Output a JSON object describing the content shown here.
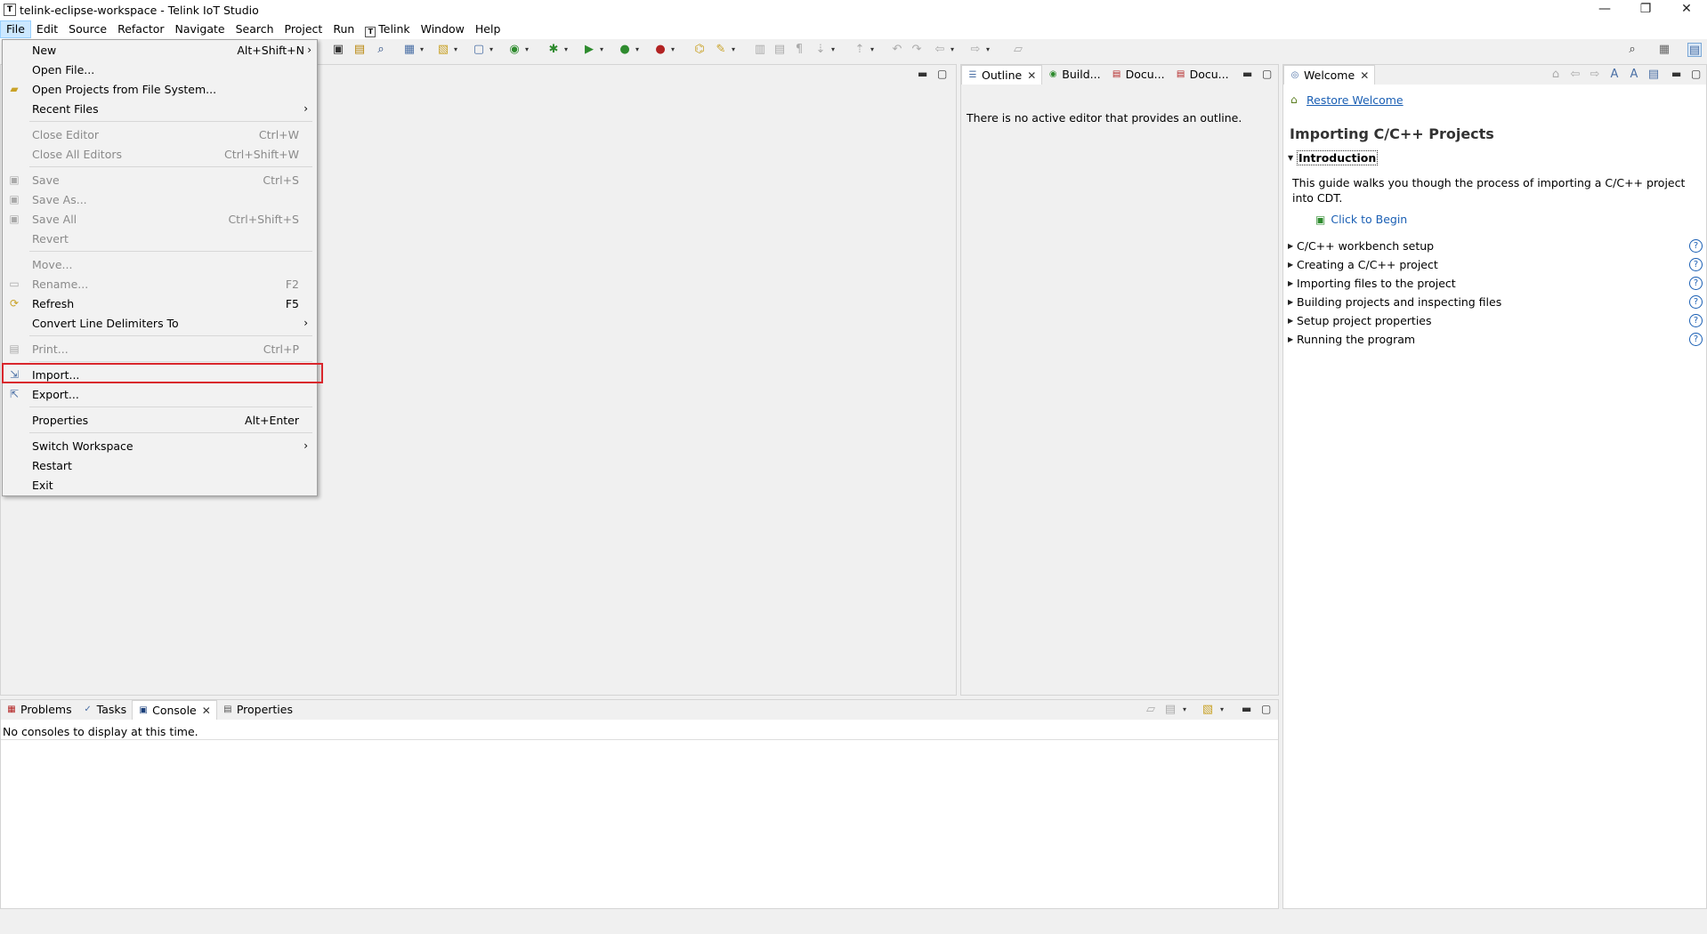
{
  "window": {
    "title": "telink-eclipse-workspace - Telink IoT Studio",
    "icon": "app-icon",
    "controls": {
      "minimize": "—",
      "restore": "❐",
      "close": "✕"
    }
  },
  "menubar": {
    "items": [
      "File",
      "Edit",
      "Source",
      "Refactor",
      "Navigate",
      "Search",
      "Project",
      "Run",
      "Telink",
      "Window",
      "Help"
    ]
  },
  "file_menu": {
    "new": {
      "label": "New",
      "shortcut": "Alt+Shift+N"
    },
    "open_file": {
      "label": "Open File..."
    },
    "open_projects": {
      "label": "Open Projects from File System..."
    },
    "recent_files": {
      "label": "Recent Files"
    },
    "close_editor": {
      "label": "Close Editor",
      "shortcut": "Ctrl+W"
    },
    "close_all_editors": {
      "label": "Close All Editors",
      "shortcut": "Ctrl+Shift+W"
    },
    "save": {
      "label": "Save",
      "shortcut": "Ctrl+S"
    },
    "save_as": {
      "label": "Save As..."
    },
    "save_all": {
      "label": "Save All",
      "shortcut": "Ctrl+Shift+S"
    },
    "revert": {
      "label": "Revert"
    },
    "move": {
      "label": "Move..."
    },
    "rename": {
      "label": "Rename...",
      "shortcut": "F2"
    },
    "refresh": {
      "label": "Refresh",
      "shortcut": "F5"
    },
    "convert": {
      "label": "Convert Line Delimiters To"
    },
    "print": {
      "label": "Print...",
      "shortcut": "Ctrl+P"
    },
    "import": {
      "label": "Import..."
    },
    "export": {
      "label": "Export..."
    },
    "properties": {
      "label": "Properties",
      "shortcut": "Alt+Enter"
    },
    "switch_workspace": {
      "label": "Switch Workspace"
    },
    "restart": {
      "label": "Restart"
    },
    "exit": {
      "label": "Exit"
    },
    "submenu_arrow": "›"
  },
  "outline": {
    "tabs": [
      "Outline",
      "Build...",
      "Docu...",
      "Docu..."
    ],
    "message": "There is no active editor that provides an outline."
  },
  "welcome": {
    "tab": "Welcome",
    "restore_link": "Restore Welcome",
    "title": "Importing C/C++ Projects",
    "intro_heading": "Introduction",
    "intro_text": "This guide walks you though the process of importing a C/C++ project into CDT.",
    "begin_link": "Click to Begin",
    "topics": [
      "C/C++ workbench setup",
      "Creating a C/C++ project",
      "Importing files to the project",
      "Building projects and inspecting files",
      "Setup project properties",
      "Running the program"
    ],
    "help_glyph": "?"
  },
  "console": {
    "tabs": [
      "Problems",
      "Tasks",
      "Console",
      "Properties"
    ],
    "message": "No consoles to display at this time."
  },
  "glyphs": {
    "close": "✕",
    "minimize": "▬",
    "maximize": "▢",
    "caret_open": "▼",
    "caret_closed": "▶",
    "dropdown": "▾"
  }
}
